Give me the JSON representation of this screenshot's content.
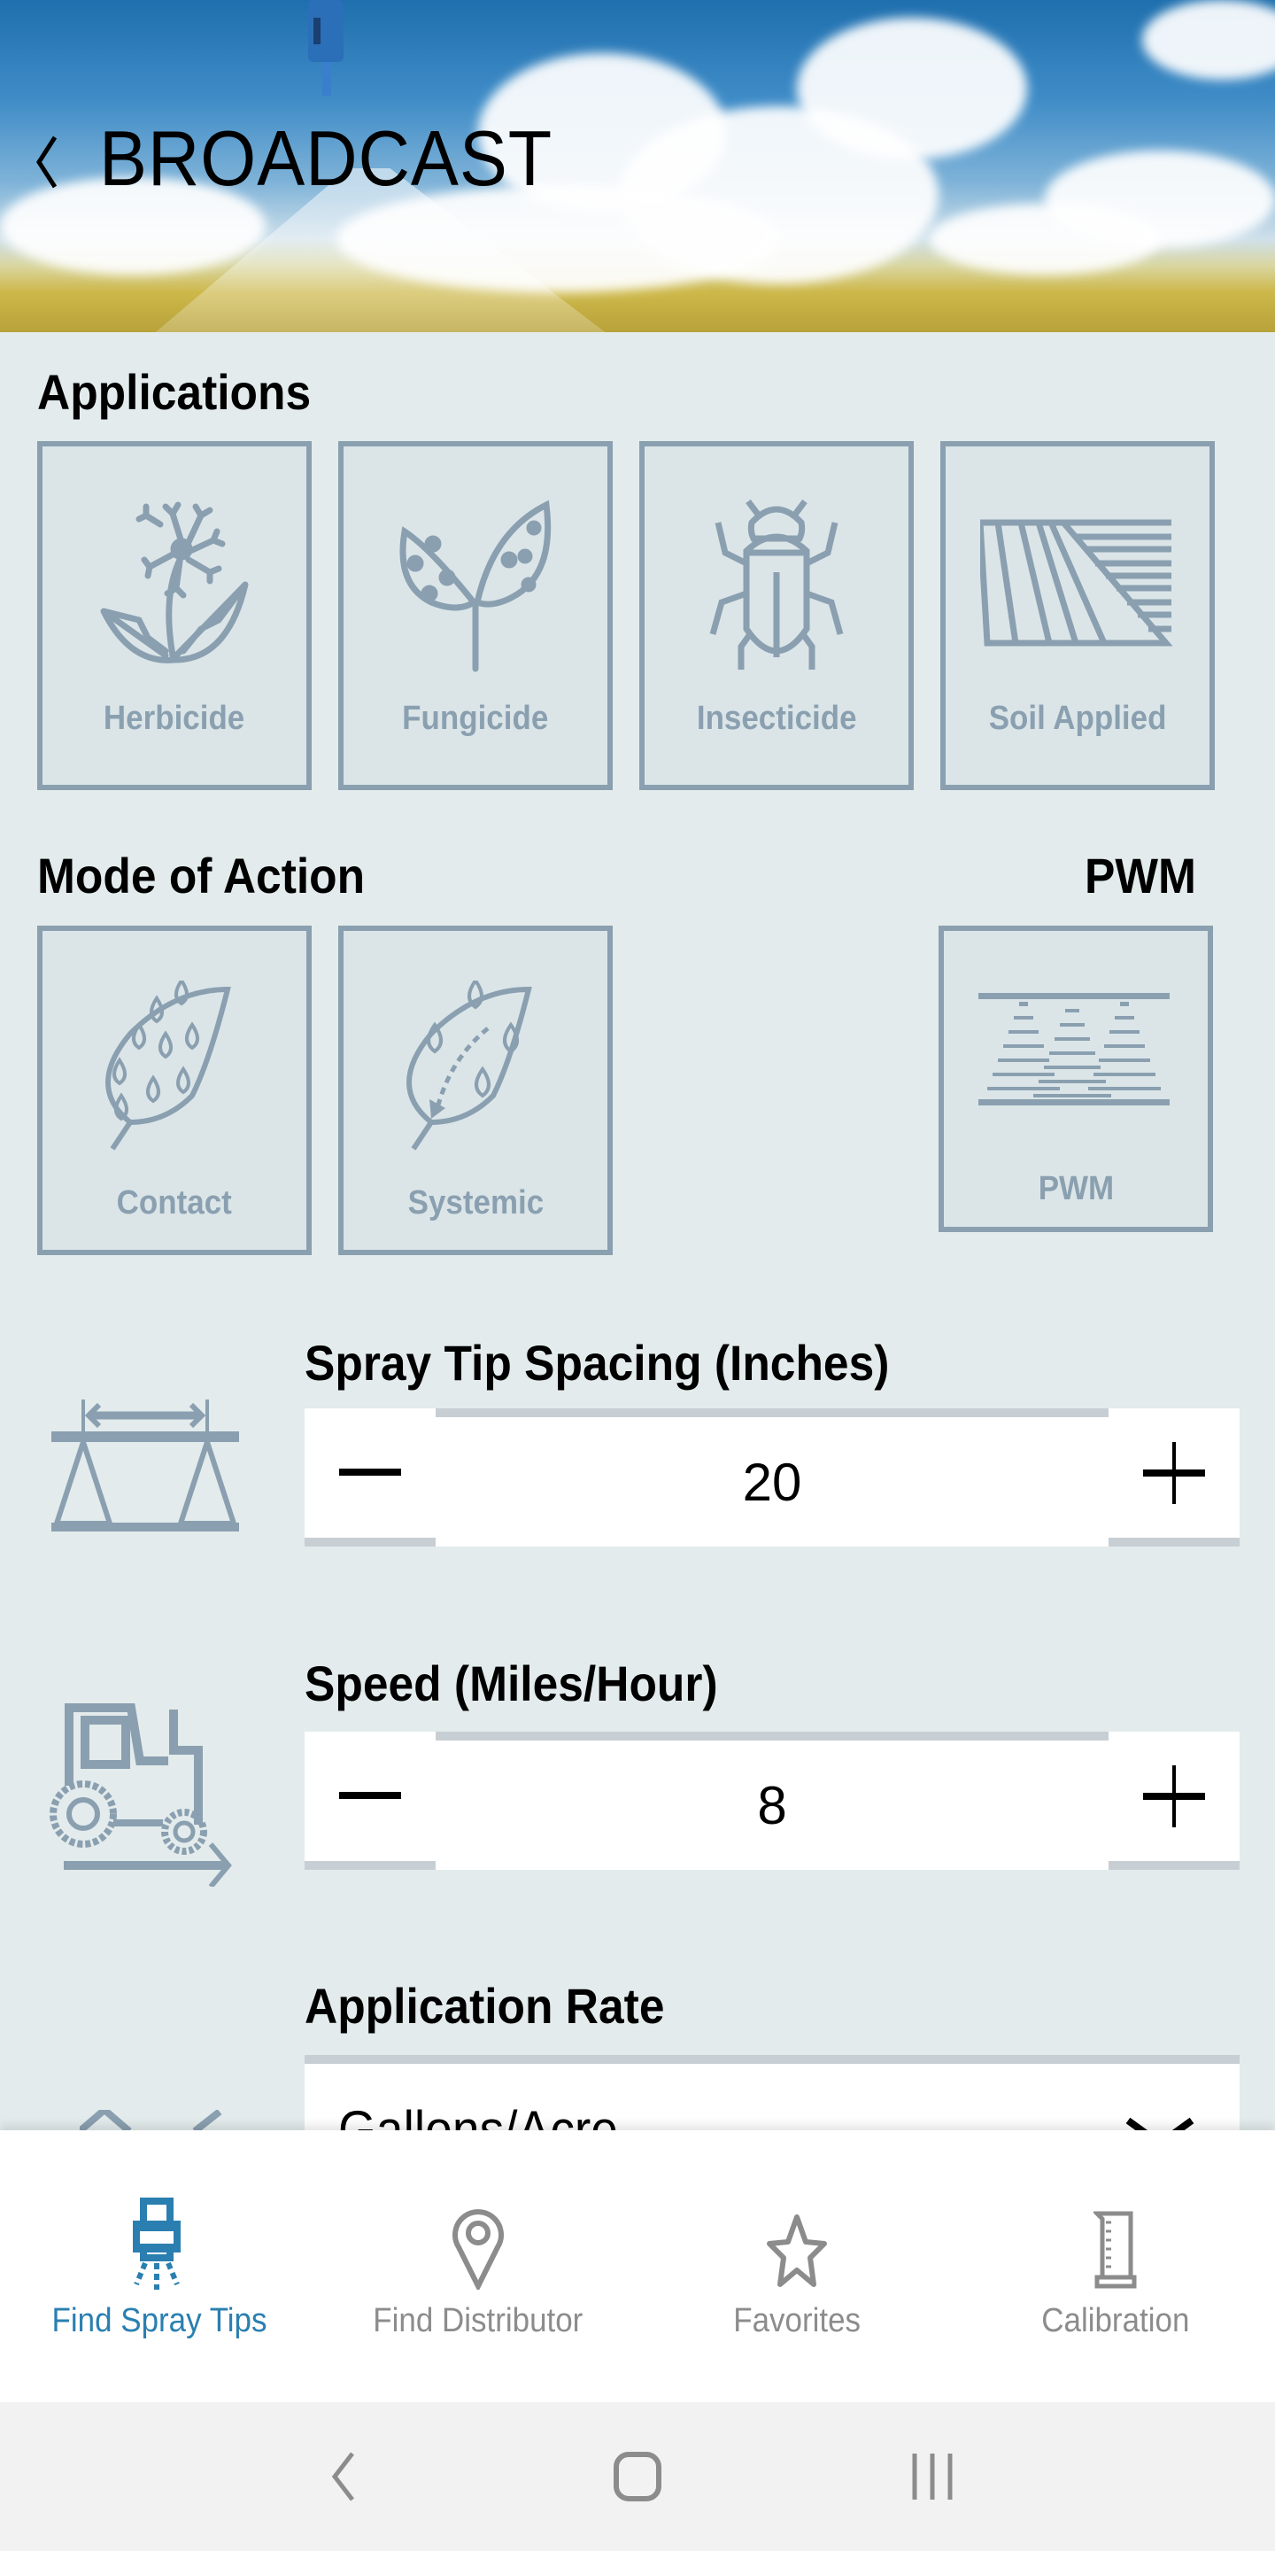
{
  "header": {
    "title": "BROADCAST",
    "back_icon": "chevron-left-icon"
  },
  "applications": {
    "title": "Applications",
    "items": [
      {
        "label": "Herbicide",
        "icon": "dandelion-icon"
      },
      {
        "label": "Fungicide",
        "icon": "spotted-leaves-icon"
      },
      {
        "label": "Insecticide",
        "icon": "beetle-icon"
      },
      {
        "label": "Soil Applied",
        "icon": "field-rows-icon"
      }
    ]
  },
  "mode_of_action": {
    "title": "Mode of Action",
    "items": [
      {
        "label": "Contact",
        "icon": "leaf-droplets-icon"
      },
      {
        "label": "Systemic",
        "icon": "leaf-systemic-icon"
      }
    ]
  },
  "pwm": {
    "title": "PWM",
    "item": {
      "label": "PWM",
      "icon": "pwm-spray-icon"
    }
  },
  "spacing": {
    "label": "Spray Tip Spacing (Inches)",
    "value": "20",
    "icon": "nozzle-spacing-icon"
  },
  "speed": {
    "label": "Speed (Miles/Hour)",
    "value": "8",
    "icon": "tractor-icon"
  },
  "application_rate": {
    "label": "Application Rate",
    "selected": "Gallons/Acre"
  },
  "bottom_nav": {
    "items": [
      {
        "label": "Find Spray Tips",
        "icon": "spray-nozzle-icon",
        "active": true
      },
      {
        "label": "Find Distributor",
        "icon": "map-pin-icon",
        "active": false
      },
      {
        "label": "Favorites",
        "icon": "star-icon",
        "active": false
      },
      {
        "label": "Calibration",
        "icon": "graduated-cylinder-icon",
        "active": false
      }
    ]
  },
  "colors": {
    "accent": "#2a7fb0",
    "tile_border": "#8aa0b0",
    "background": "#e3ebec",
    "inactive_nav": "#8c8c8c"
  }
}
